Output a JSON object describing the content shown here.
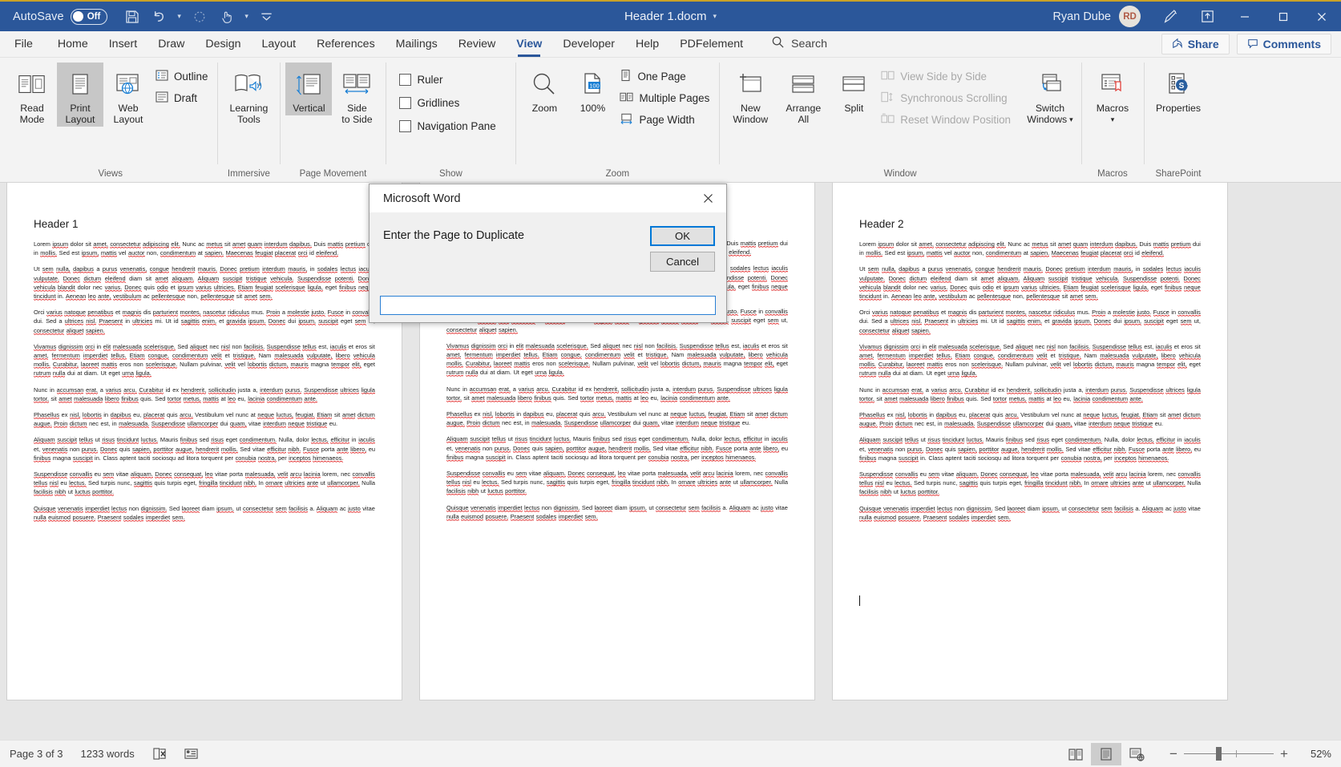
{
  "titlebar": {
    "autosave_label": "AutoSave",
    "autosave_state": "Off",
    "document_title": "Header 1.docm",
    "user_name": "Ryan Dube",
    "user_initials": "RD",
    "accent_color": "#2b579a"
  },
  "tabs": [
    {
      "label": "File",
      "active": false
    },
    {
      "label": "Home",
      "active": false
    },
    {
      "label": "Insert",
      "active": false
    },
    {
      "label": "Draw",
      "active": false
    },
    {
      "label": "Design",
      "active": false
    },
    {
      "label": "Layout",
      "active": false
    },
    {
      "label": "References",
      "active": false
    },
    {
      "label": "Mailings",
      "active": false
    },
    {
      "label": "Review",
      "active": false
    },
    {
      "label": "View",
      "active": true
    },
    {
      "label": "Developer",
      "active": false
    },
    {
      "label": "Help",
      "active": false
    },
    {
      "label": "PDFelement",
      "active": false
    }
  ],
  "search": {
    "placeholder": "Search"
  },
  "tabbar_right": {
    "share_label": "Share",
    "comments_label": "Comments"
  },
  "ribbon": {
    "groups": [
      {
        "label": "Views",
        "big": [
          {
            "label": "Read Mode",
            "line1": "Read",
            "line2": "Mode",
            "selected": false,
            "icon": "read-mode-icon"
          },
          {
            "label": "Print Layout",
            "line1": "Print",
            "line2": "Layout",
            "selected": true,
            "icon": "print-layout-icon"
          },
          {
            "label": "Web Layout",
            "line1": "Web",
            "line2": "Layout",
            "selected": false,
            "icon": "web-layout-icon"
          }
        ],
        "small": [
          {
            "label": "Outline",
            "icon": "outline-icon",
            "disabled": false
          },
          {
            "label": "Draft",
            "icon": "draft-icon",
            "disabled": false
          }
        ]
      },
      {
        "label": "Immersive",
        "big": [
          {
            "label": "Learning Tools",
            "line1": "Learning",
            "line2": "Tools",
            "selected": false,
            "icon": "learning-tools-icon"
          }
        ],
        "small": []
      },
      {
        "label": "Page Movement",
        "big": [
          {
            "label": "Vertical",
            "line1": "Vertical",
            "line2": "",
            "selected": true,
            "icon": "vertical-icon"
          },
          {
            "label": "Side to Side",
            "line1": "Side",
            "line2": "to Side",
            "selected": false,
            "icon": "side-to-side-icon"
          }
        ],
        "small": []
      },
      {
        "label": "Show",
        "big": [],
        "small": [
          {
            "label": "Ruler",
            "icon": "checkbox-icon",
            "checked": false
          },
          {
            "label": "Gridlines",
            "icon": "checkbox-icon",
            "checked": false
          },
          {
            "label": "Navigation Pane",
            "icon": "checkbox-icon",
            "checked": false
          }
        ]
      },
      {
        "label": "Zoom",
        "big": [
          {
            "label": "Zoom",
            "line1": "Zoom",
            "line2": "",
            "selected": false,
            "icon": "zoom-magnifier-icon"
          },
          {
            "label": "100%",
            "line1": "100%",
            "line2": "",
            "selected": false,
            "icon": "zoom-100-icon"
          }
        ],
        "small": [
          {
            "label": "One Page",
            "icon": "one-page-icon",
            "disabled": false
          },
          {
            "label": "Multiple Pages",
            "icon": "multiple-pages-icon",
            "disabled": false
          },
          {
            "label": "Page Width",
            "icon": "page-width-icon",
            "disabled": false
          }
        ]
      },
      {
        "label": "Window",
        "big": [
          {
            "label": "New Window",
            "line1": "New",
            "line2": "Window",
            "selected": false,
            "icon": "new-window-icon"
          },
          {
            "label": "Arrange All",
            "line1": "Arrange",
            "line2": "All",
            "selected": false,
            "icon": "arrange-all-icon"
          },
          {
            "label": "Split",
            "line1": "Split",
            "line2": "",
            "selected": false,
            "icon": "split-icon"
          }
        ],
        "small": [
          {
            "label": "View Side by Side",
            "icon": "view-side-by-side-icon",
            "disabled": true
          },
          {
            "label": "Synchronous Scrolling",
            "icon": "synchronous-scrolling-icon",
            "disabled": true
          },
          {
            "label": "Reset Window Position",
            "icon": "reset-window-position-icon",
            "disabled": true
          }
        ],
        "big_right": [
          {
            "label": "Switch Windows",
            "line1": "Switch",
            "line2": "Windows",
            "dropdown": true,
            "icon": "switch-windows-icon"
          }
        ]
      },
      {
        "label": "Macros",
        "big": [
          {
            "label": "Macros",
            "line1": "Macros",
            "line2": "",
            "dropdown": true,
            "icon": "macros-icon"
          }
        ],
        "small": []
      },
      {
        "label": "SharePoint",
        "big": [
          {
            "label": "Properties",
            "line1": "Properties",
            "line2": "",
            "selected": false,
            "icon": "properties-icon"
          }
        ],
        "small": []
      }
    ]
  },
  "document": {
    "pages": [
      {
        "heading": "Header 1",
        "paragraphs": [
          "Lorem ipsum dolor sit amet, consectetur adipiscing elit. Nunc ac metus sit amet quam interdum dapibus. Duis mattis pretium dui in mollis. Sed est ipsum, mattis vel auctor non, condimentum at sapien. Maecenas feugiat placerat orci id eleifend.",
          "Ut sem nulla, dapibus a purus venenatis, congue hendrerit mauris. Donec pretium interdum mauris, in sodales lectus iaculis vulputate. Donec dictum eleifend diam sit amet aliquam. Aliquam suscipit tristique vehicula. Suspendisse potenti. Donec vehicula blandit dolor nec varius. Donec quis odio et ipsum varius ultricies. Etiam feugiat scelerisque ligula, eget finibus neque tincidunt in. Aenean leo ante, vestibulum ac pellentesque non, pellentesque sit amet sem.",
          "Orci varius natoque penatibus et magnis dis parturient montes, nascetur ridiculus mus. Proin a molestie justo. Fusce in convallis dui. Sed a ultrices nisl. Praesent in ultricies mi. Ut id sagittis enim, et gravida ipsum. Donec dui ipsum, suscipit eget sem ut, consectetur aliquet sapien.",
          "Vivamus dignissim orci in elit malesuada scelerisque. Sed aliquet nec nisl non facilisis. Suspendisse tellus est, iaculis et eros sit amet, fermentum imperdiet tellus. Etiam congue, condimentum velit et tristique. Nam malesuada vulputate, libero vehicula mollis. Curabitur, laoreet mattis eros non scelerisque. Nullam pulvinar, velit vel lobortis dictum, mauris magna tempor elit, eget rutrum nulla dui at diam. Ut eget urna ligula.",
          "Nunc in accumsan erat, a varius arcu. Curabitur id ex hendrerit, sollicitudin justa a, interdum purus. Suspendisse ultrices ligula tortor, sit amet malesuada libero finibus quis. Sed tortor metus, mattis at leo eu, lacinia condimentum ante.",
          "Phasellus ex nisl, lobortis in dapibus eu, placerat quis arcu. Vestibulum vel nunc at neque luctus, feugiat. Etiam sit amet dictum augue. Proin dictum nec est, in malesuada. Suspendisse ullamcorper dui quam, vitae interdum neque tristique eu.",
          "Aliquam suscipit tellus ut risus tincidunt luctus. Mauris finibus sed risus eget condimentum. Nulla, dolor lectus, efficitur in iaculis et, venenatis non purus. Donec quis sapien, porttitor augue, hendrerit mollis. Sed vitae efficitur nibh. Fusce porta ante libero, eu finibus magna suscipit in. Class aptent taciti sociosqu ad litora torquent per conubia nostra, per inceptos himenaeos.",
          "Suspendisse convallis eu sem vitae aliquam. Donec consequat, leo vitae porta malesuada, velit arcu lacinia lorem, nec convallis tellus nisl eu lectus. Sed turpis nunc, sagittis quis turpis eget, fringilla tincidunt nibh. In ornare ultricies ante ut ullamcorper. Nulla facilisis nibh ut luctus porttitor.",
          "Quisque venenatis imperdiet lectus non dignissim. Sed laoreet diam ipsum, ut consectetur sem facilisis a. Aliquam ac justo vitae nulla euismod posuere. Praesent sodales imperdiet sem."
        ]
      },
      {
        "heading": "",
        "paragraphs": [
          "Lorem ipsum dolor sit amet, consectetur adipiscing elit. Nunc ac metus sit amet quam interdum dapibus. Duis mattis pretium dui in mollis. Sed est ipsum, mattis vel auctor non, condimentum at sapien. Maecenas feugiat placerat orci id eleifend.",
          "Ut sem nulla, dapibus a purus venenatis, congue hendrerit mauris. Donec pretium interdum mauris, in sodales lectus iaculis vulputate. Donec dictum eleifend diam sit amet aliquam. Aliquam suscipit tristique vehicula. Suspendisse potenti. Donec vehicula blandit dolor nec varius. Donec quis odio et ipsum varius ultricies. Etiam feugiat scelerisque ligula, eget finibus neque tincidunt in. Aenean leo ante, vestibulum ac pellentesque non, pellentesque sit amet sem.",
          "Orci varius natoque penatibus et magnis dis parturient montes, nascetur ridiculus mus. Proin a molestie justo. Fusce in convallis dui. Sed a ultrices nisl. Praesent in ultricies mi. Ut id sagittis enim, et gravida ipsum. Donec dui ipsum, suscipit eget sem ut, consectetur aliquet sapien.",
          "Vivamus dignissim orci in elit malesuada scelerisque. Sed aliquet nec nisl non facilisis. Suspendisse tellus est, iaculis et eros sit amet, fermentum imperdiet tellus. Etiam congue, condimentum velit et tristique. Nam malesuada vulputate, libero vehicula mollis. Curabitur, laoreet mattis eros non scelerisque. Nullam pulvinar, velit vel lobortis dictum, mauris magna tempor elit, eget rutrum nulla dui at diam. Ut eget urna ligula.",
          "Nunc in accumsan erat, a varius arcu. Curabitur id ex hendrerit, sollicitudin justa a, interdum purus. Suspendisse ultrices ligula tortor, sit amet malesuada libero finibus quis. Sed tortor metus, mattis at leo eu, lacinia condimentum ante.",
          "Phasellus ex nisl, lobortis in dapibus eu, placerat quis arcu. Vestibulum vel nunc at neque luctus, feugiat. Etiam sit amet dictum augue. Proin dictum nec est, in malesuada. Suspendisse ullamcorper dui quam, vitae interdum neque tristique eu.",
          "Aliquam suscipit tellus ut risus tincidunt luctus. Mauris finibus sed risus eget condimentum. Nulla, dolor lectus, efficitur in iaculis et, venenatis non purus. Donec quis sapien, porttitor augue, hendrerit mollis. Sed vitae efficitur nibh. Fusce porta ante libero, eu finibus magna suscipit in. Class aptent taciti sociosqu ad litora torquent per conubia nostra, per inceptos himenaeos.",
          "Suspendisse convallis eu sem vitae aliquam. Donec consequat, leo vitae porta malesuada, velit arcu lacinia lorem, nec convallis tellus nisl eu lectus. Sed turpis nunc, sagittis quis turpis eget, fringilla tincidunt nibh. In ornare ultricies ante ut ullamcorper. Nulla facilisis nibh ut luctus porttitor.",
          "Quisque venenatis imperdiet lectus non dignissim. Sed laoreet diam ipsum, ut consectetur sem facilisis a. Aliquam ac justo vitae nulla euismod posuere. Praesent sodales imperdiet sem."
        ]
      },
      {
        "heading": "Header 2",
        "paragraphs": [
          "Lorem ipsum dolor sit amet, consectetur adipiscing elit. Nunc ac metus sit amet quam interdum dapibus. Duis mattis pretium dui in mollis. Sed est ipsum, mattis vel auctor non, condimentum at sapien. Maecenas feugiat placerat orci id eleifend.",
          "Ut sem nulla, dapibus a purus venenatis, congue hendrerit mauris. Donec pretium interdum mauris, in sodales lectus iaculis vulputate. Donec dictum eleifend diam sit amet aliquam. Aliquam suscipit tristique vehicula. Suspendisse potenti. Donec vehicula blandit dolor nec varius. Donec quis odio et ipsum varius ultricies. Etiam feugiat scelerisque ligula, eget finibus neque tincidunt in. Aenean leo ante, vestibulum ac pellentesque non, pellentesque sit amet sem.",
          "Orci varius natoque penatibus et magnis dis parturient montes, nascetur ridiculus mus. Proin a molestie justo. Fusce in convallis dui. Sed a ultrices nisl. Praesent in ultricies mi. Ut id sagittis enim, et gravida ipsum. Donec dui ipsum, suscipit eget sem ut, consectetur aliquet sapien.",
          "Vivamus dignissim orci in elit malesuada scelerisque. Sed aliquet nec nisl non facilisis. Suspendisse tellus est, iaculis et eros sit amet, fermentum imperdiet tellus. Etiam congue, condimentum velit et tristique. Nam malesuada vulputate, libero vehicula mollis. Curabitur, laoreet mattis eros non scelerisque. Nullam pulvinar, velit vel lobortis dictum, mauris magna tempor elit, eget rutrum nulla dui at diam. Ut eget urna ligula.",
          "Nunc in accumsan erat, a varius arcu. Curabitur id ex hendrerit, sollicitudin justa a, interdum purus. Suspendisse ultrices ligula tortor, sit amet malesuada libero finibus quis. Sed tortor metus, mattis at leo eu, lacinia condimentum ante.",
          "Phasellus ex nisl, lobortis in dapibus eu, placerat quis arcu. Vestibulum vel nunc at neque luctus, feugiat. Etiam sit amet dictum augue. Proin dictum nec est, in malesuada. Suspendisse ullamcorper dui quam, vitae interdum neque tristique eu.",
          "Aliquam suscipit tellus ut risus tincidunt luctus. Mauris finibus sed risus eget condimentum. Nulla, dolor lectus, efficitur in iaculis et, venenatis non purus. Donec quis sapien, porttitor augue, hendrerit mollis. Sed vitae efficitur nibh. Fusce porta ante libero, eu finibus magna suscipit in. Class aptent taciti sociosqu ad litora torquent per conubia nostra, per inceptos himenaeos.",
          "Suspendisse convallis eu sem vitae aliquam. Donec consequat, leo vitae porta malesuada, velit arcu lacinia lorem, nec convallis tellus nisl eu lectus. Sed turpis nunc, sagittis quis turpis eget, fringilla tincidunt nibh. In ornare ultricies ante ut ullamcorper. Nulla facilisis nibh ut luctus porttitor.",
          "Quisque venenatis imperdiet lectus non dignissim. Sed laoreet diam ipsum, ut consectetur sem facilisis a. Aliquam ac justo vitae nulla euismod posuere. Praesent sodales imperdiet sem."
        ]
      }
    ]
  },
  "dialog": {
    "title": "Microsoft Word",
    "prompt": "Enter the Page to Duplicate",
    "ok_label": "OK",
    "cancel_label": "Cancel",
    "input_value": "",
    "focus_color": "#0078d7"
  },
  "statusbar": {
    "page_info": "Page 3 of 3",
    "word_count": "1233 words",
    "proofing_icon": "proofing-errors-icon",
    "accessibility_icon": "accessibility-icon",
    "view_buttons": [
      {
        "name": "read-mode-view",
        "selected": false
      },
      {
        "name": "print-layout-view",
        "selected": true
      },
      {
        "name": "web-layout-view",
        "selected": false
      }
    ],
    "zoom_minus": "−",
    "zoom_plus": "+",
    "zoom_level": "52%"
  }
}
